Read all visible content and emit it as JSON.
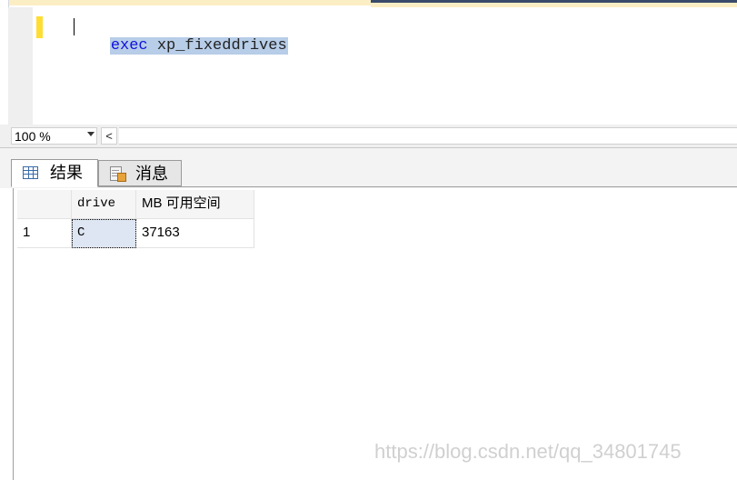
{
  "editor": {
    "code_keyword": "exec",
    "code_rest": " xp_fixeddrives"
  },
  "zoom": {
    "value": "100 %",
    "scroll_left_glyph": "<"
  },
  "tabs": [
    {
      "label": "结果",
      "icon": "grid-icon",
      "active": true
    },
    {
      "label": "消息",
      "icon": "message-icon",
      "active": false
    }
  ],
  "results": {
    "columns": [
      "",
      "drive",
      "MB 可用空间"
    ],
    "rows": [
      [
        "1",
        "C",
        "37163"
      ]
    ]
  },
  "watermark": "https://blog.csdn.net/qq_34801745",
  "colors": {
    "selection": "#b7cde8",
    "keyword": "#1010dd",
    "change_marker": "#ffdd33"
  }
}
